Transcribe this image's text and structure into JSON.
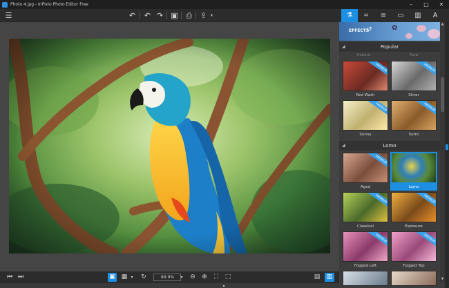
{
  "window": {
    "title": "Photo 4.jpg - InPixio Photo Editor Free",
    "controls": [
      "–",
      "□",
      "✕"
    ]
  },
  "toolbar": {
    "menu": "☰",
    "undo": "↶",
    "undo2": "↶",
    "redo": "↷",
    "save": "▣",
    "print": "⎙",
    "share": "⇪"
  },
  "tool_tabs": [
    "⚗",
    "⌗",
    "≡",
    "▭",
    "▥",
    "A"
  ],
  "canvas": {
    "zoom": "89.9%"
  },
  "effects": {
    "header": "EFFECTS",
    "sections": [
      {
        "title": "Popular",
        "faded_top": [
          "Instant",
          "Pure"
        ],
        "items": [
          {
            "name": "Red Wash",
            "premium": "PREMIUM"
          },
          {
            "name": "Silver",
            "premium": "PREMIUM"
          },
          {
            "name": "Sunny",
            "premium": "PREMIUM"
          },
          {
            "name": "Sutro",
            "premium": "PREMIUM"
          }
        ]
      },
      {
        "title": "Lomo",
        "items": [
          {
            "name": "Aged",
            "premium": "PREMIUM"
          },
          {
            "name": "Lomo",
            "premium": ""
          },
          {
            "name": "Classical",
            "premium": "PREMIUM"
          },
          {
            "name": "Exposure",
            "premium": "PREMIUM"
          },
          {
            "name": "Fogged Left",
            "premium": "PREMIUM"
          },
          {
            "name": "Fogged Top",
            "premium": "PREMIUM"
          }
        ]
      }
    ],
    "selected": "Lomo"
  },
  "colors": {
    "accent": "#1c8fe3",
    "toolbar": "#2c2c2c",
    "canvas": "#454545",
    "panel": "#3d3d3d"
  }
}
